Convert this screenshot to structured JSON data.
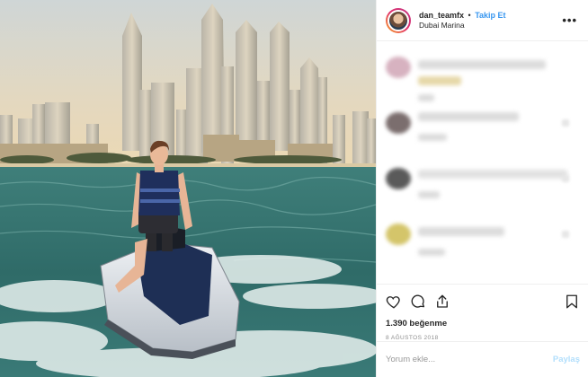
{
  "header": {
    "username": "dan_teamfx",
    "separator": "•",
    "follow_label": "Takip Et",
    "location": "Dubai Marina",
    "more_icon": "ellipsis-icon"
  },
  "photo": {
    "subject": "man-on-jet-ski",
    "scene": "dubai-marina-skyline"
  },
  "comments": {
    "blurred": true,
    "count": 4
  },
  "actions": {
    "icons": [
      "heart-icon",
      "comment-icon",
      "share-icon",
      "bookmark-icon"
    ],
    "likes": "1.390 beğenme",
    "date": "8 AĞUSTOS 2018"
  },
  "add_comment": {
    "placeholder": "Yorum ekle...",
    "post_label": "Paylaş"
  },
  "colors": {
    "accent": "#3897f0",
    "post_disabled": "#b2dffc",
    "border": "#efefef",
    "muted": "#8e8e8e"
  }
}
